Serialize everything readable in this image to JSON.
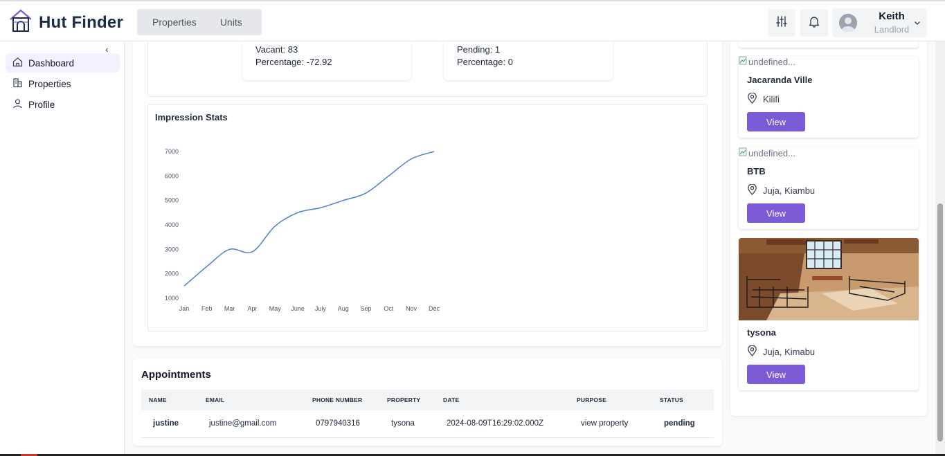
{
  "app": {
    "name": "Hut Finder",
    "accent": "#7c5cd6",
    "brand_color": "#1e2a4a"
  },
  "header": {
    "tabs": [
      {
        "label": "Properties"
      },
      {
        "label": "Units"
      }
    ],
    "user": {
      "name": "Keith",
      "role": "Landlord"
    },
    "icons": [
      "sliders-icon",
      "bell-icon",
      "chevron-down-icon"
    ]
  },
  "sidebar": {
    "collapse_glyph": "‹",
    "items": [
      {
        "label": "Dashboard",
        "icon": "home-icon",
        "active": true
      },
      {
        "label": "Properties",
        "icon": "building-icon",
        "active": false
      },
      {
        "label": "Profile",
        "icon": "user-icon",
        "active": false
      }
    ]
  },
  "summary": {
    "vacant": "Vacant: 83",
    "vacant_percentage": "Percentage: -72.92",
    "pending": "Pending: 1",
    "pending_percentage": "Percentage: 0"
  },
  "impressions": {
    "title": "Impression Stats"
  },
  "chart_data": {
    "type": "line",
    "title": "Impression Stats",
    "categories": [
      "Jan",
      "Feb",
      "Mar",
      "Apr",
      "May",
      "June",
      "July",
      "Aug",
      "Sep",
      "Oct",
      "Nov",
      "Dec"
    ],
    "series": [
      {
        "values": [
          1500,
          2300,
          3000,
          2900,
          3950,
          4500,
          4700,
          5000,
          5300,
          6000,
          6700,
          7000
        ],
        "color": "#4a7fd4"
      }
    ],
    "yticks": [
      1000,
      2000,
      3000,
      4000,
      5000,
      6000,
      7000
    ],
    "ylim": [
      1000,
      7000
    ],
    "grid": false,
    "legend": "none"
  },
  "appointments": {
    "title": "Appointments",
    "columns": [
      "NAME",
      "EMAIL",
      "PHONE NUMBER",
      "PROPERTY",
      "DATE",
      "PURPOSE",
      "STATUS"
    ],
    "rows": [
      {
        "name": "justine",
        "email": "justine@gmail.com",
        "phone": "0797940316",
        "property": "tysona",
        "date": "2024-08-09T16:29:02.000Z",
        "purpose": "view property",
        "status": "pending"
      }
    ]
  },
  "properties": [
    {
      "image_alt": "undefined...",
      "name": "Jacaranda Ville",
      "location": "Kilifi",
      "button": "View"
    },
    {
      "image_alt": "undefined...",
      "name": "BTB",
      "location": "Juja, Kiambu",
      "button": "View"
    },
    {
      "image": "room-photo",
      "name": "tysona",
      "location": "Juja, Kimabu",
      "button": "View"
    }
  ]
}
